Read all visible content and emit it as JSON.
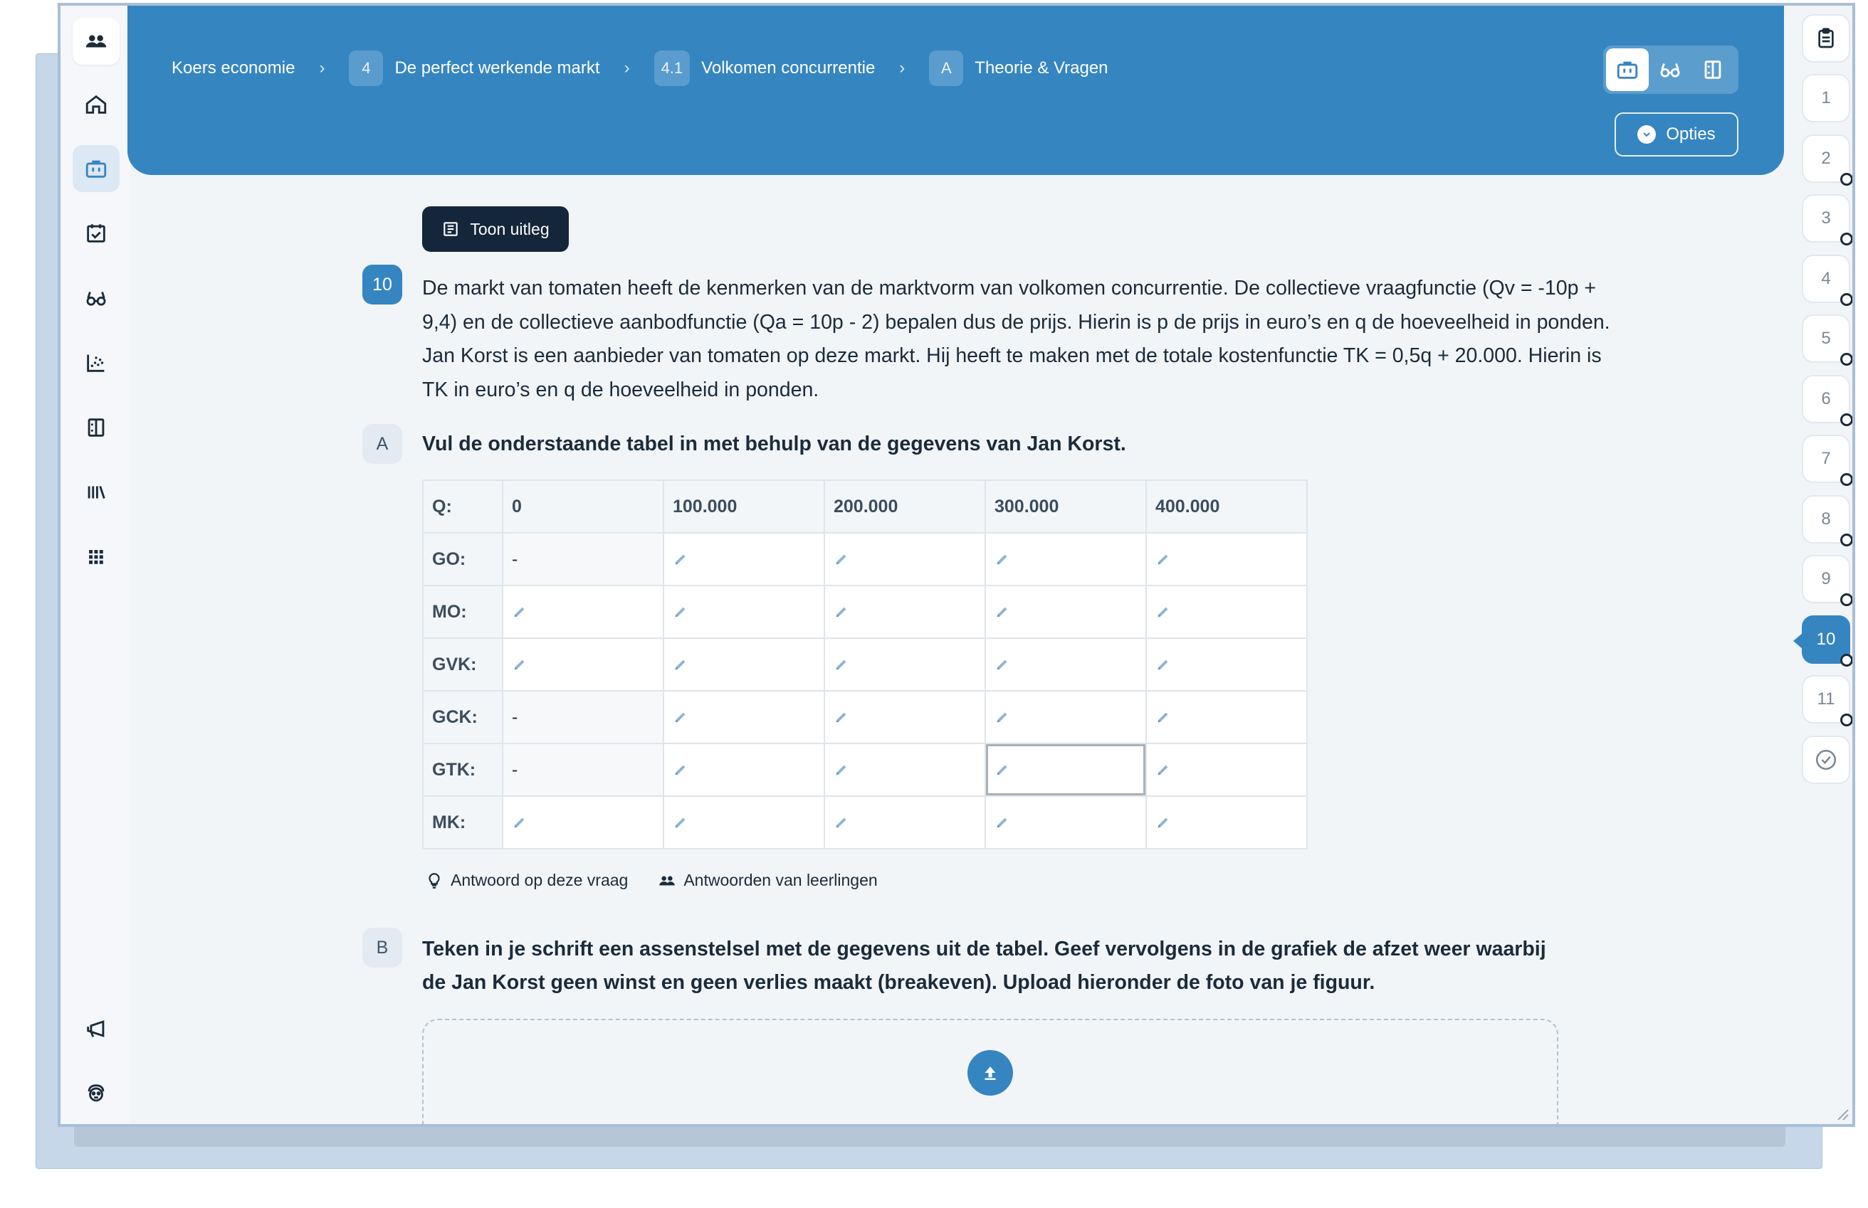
{
  "breadcrumb": {
    "course": "Koers economie",
    "chapter_num": "4",
    "chapter": "De perfect werkende markt",
    "section_num": "4.1",
    "section": "Volkomen concurrentie",
    "part_num": "A",
    "part": "Theorie & Vragen",
    "separator": "›"
  },
  "header": {
    "options_label": "Opties"
  },
  "sidebar": {
    "items": [
      "people-icon",
      "home-icon",
      "briefcase-icon",
      "calendar-check-icon",
      "glasses-icon",
      "scatter-chart-icon",
      "columns-icon",
      "library-icon",
      "grid-icon",
      "megaphone-icon",
      "mascot-icon"
    ]
  },
  "question_nav": {
    "items": [
      "1",
      "2",
      "3",
      "4",
      "5",
      "6",
      "7",
      "8",
      "9",
      "10",
      "11"
    ],
    "current": "10"
  },
  "content": {
    "toon_uitleg": "Toon uitleg",
    "question_number": "10",
    "question_text": "De markt van tomaten heeft de kenmerken van de marktvorm van volkomen concurrentie. De collectieve vraagfunctie (Qv = -10p + 9,4) en de collectieve aanbodfunctie (Qa = 10p - 2) bepalen dus de prijs. Hierin is p de prijs in euro’s en q de hoeveelheid in ponden. Jan Korst is een aanbieder van tomaten op deze markt. Hij heeft te maken met de totale kostenfunctie TK = 0,5q + 20.000. Hierin is TK in euro’s en q de hoeveelheid in ponden.",
    "sub_a_label": "A",
    "sub_a_text": "Vul de onderstaande tabel in met behulp van de gegevens van Jan Korst.",
    "table": {
      "header_label": "Q:",
      "columns": [
        "0",
        "100.000",
        "200.000",
        "300.000",
        "400.000"
      ],
      "rows": [
        {
          "label": "GO:",
          "cells": [
            "-",
            "edit",
            "edit",
            "edit",
            "edit"
          ]
        },
        {
          "label": "MO:",
          "cells": [
            "edit",
            "edit",
            "edit",
            "edit",
            "edit"
          ]
        },
        {
          "label": "GVK:",
          "cells": [
            "edit",
            "edit",
            "edit",
            "edit",
            "edit"
          ]
        },
        {
          "label": "GCK:",
          "cells": [
            "-",
            "edit",
            "edit",
            "edit",
            "edit"
          ]
        },
        {
          "label": "GTK:",
          "cells": [
            "-",
            "edit",
            "edit",
            "edit",
            "edit"
          ]
        },
        {
          "label": "MK:",
          "cells": [
            "edit",
            "edit",
            "edit",
            "edit",
            "edit"
          ]
        }
      ]
    },
    "answer_link": "Antwoord op deze vraag",
    "students_link": "Antwoorden van leerlingen",
    "sub_b_label": "B",
    "sub_b_text": "Teken in je schrift een assenstelsel met de gegevens uit de tabel. Geef vervolgens in de grafiek de afzet weer waarbij de Jan Korst geen winst en geen verlies maakt (breakeven). Upload hieronder de foto van je figuur."
  },
  "colors": {
    "header_blue": "#3585c1",
    "dark_button": "#14263a",
    "page_bg": "#f2f5f8"
  }
}
